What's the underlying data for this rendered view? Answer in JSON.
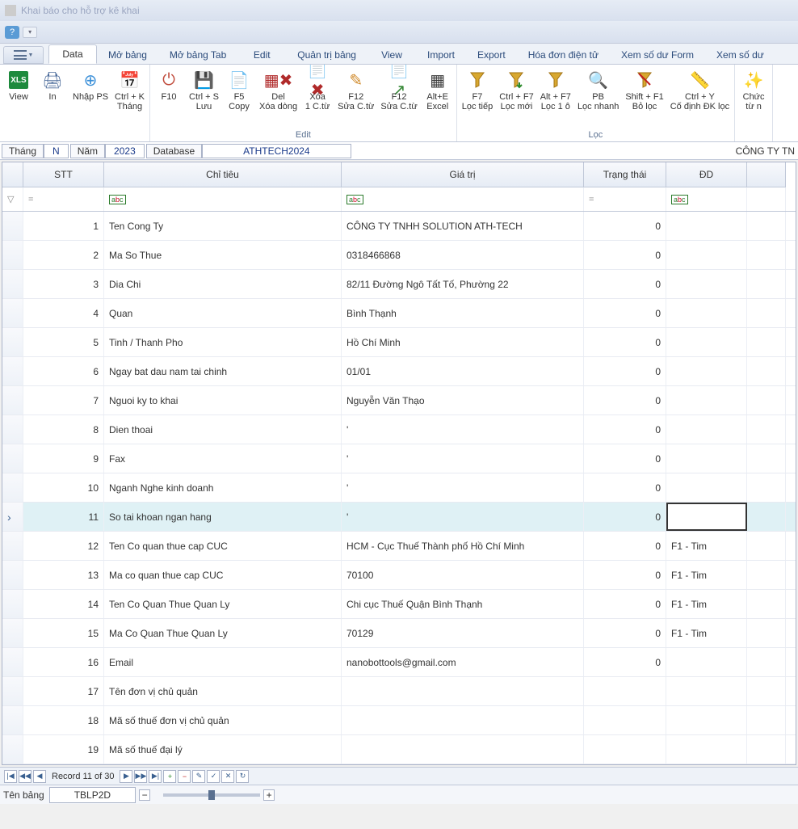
{
  "window": {
    "title": "Khai báo cho hỗ trợ kê khai"
  },
  "qat": {
    "help": "?"
  },
  "tabs": {
    "data": "Data",
    "moBang": "Mở bảng",
    "moBangTab": "Mở bảng Tab",
    "edit": "Edit",
    "quanTriBang": "Quản trị bảng",
    "view": "View",
    "import": "Import",
    "export": "Export",
    "hoaDon": "Hóa đơn điện tử",
    "xemSoDuForm": "Xem số dư Form",
    "xemSoDu": "Xem số dư"
  },
  "ribbon": {
    "view": "View",
    "in": "In",
    "nhapPs": "Nhập PS",
    "ctrlKThang": "Ctrl + K\nTháng",
    "f10": "F10",
    "ctrlSLuu": "Ctrl + S\nLưu",
    "f5Copy": "F5\nCopy",
    "delXoaDong": "Del\nXóa dòng",
    "xoa1Ctu": "Xóa\n1 C.từ",
    "f12SuaCtu": "F12\nSửa C.từ",
    "f12SuaCtu2": "F12\nSửa C.từ",
    "altEExcel": "Alt+E\nExcel",
    "f7LocTiep": "F7\nLọc tiếp",
    "ctrlF7LocMoi": "Ctrl + F7\nLọc mới",
    "altF7Loc1o": "Alt + F7\nLọc 1 ô",
    "pbLocNhanh": "PB\nLọc nhanh",
    "shiftF1BoLoc": "Shift + F1\nBỏ lọc",
    "ctrlYCoDinh": "Ctrl + Y\nCố định ĐK lọc",
    "chuc": "Chức\ntừ n",
    "groupEdit": "Edit",
    "groupLoc": "Lọc"
  },
  "info": {
    "thangLbl": "Tháng",
    "thangVal": "N",
    "namLbl": "Năm",
    "namVal": "2023",
    "dbLbl": "Database",
    "dbVal": "ATHTECH2024",
    "company": "CÔNG TY TN"
  },
  "grid": {
    "headers": {
      "stt": "STT",
      "chiTieu": "Chỉ tiêu",
      "giaTri": "Giá trị",
      "trangThai": "Trạng thái",
      "dd": "ĐD"
    },
    "filterEq": "=",
    "filterAbc": "abc",
    "rows": [
      {
        "stt": "1",
        "chiTieu": "Ten Cong Ty",
        "giaTri": "CÔNG TY TNHH SOLUTION ATH-TECH",
        "trang": "0",
        "dd": ""
      },
      {
        "stt": "2",
        "chiTieu": "Ma So Thue",
        "giaTri": "0318466868",
        "trang": "0",
        "dd": ""
      },
      {
        "stt": "3",
        "chiTieu": "Dia Chi",
        "giaTri": "82/11 Đường Ngô Tất Tố, Phường 22",
        "trang": "0",
        "dd": ""
      },
      {
        "stt": "4",
        "chiTieu": "Quan",
        "giaTri": "Bình Thạnh",
        "trang": "0",
        "dd": ""
      },
      {
        "stt": "5",
        "chiTieu": "Tinh / Thanh Pho",
        "giaTri": "Hồ Chí Minh",
        "trang": "0",
        "dd": ""
      },
      {
        "stt": "6",
        "chiTieu": "Ngay bat dau nam tai chinh",
        "giaTri": "01/01",
        "trang": "0",
        "dd": ""
      },
      {
        "stt": "7",
        "chiTieu": "Nguoi ky to khai",
        "giaTri": "Nguyễn Văn Thạo",
        "trang": "0",
        "dd": ""
      },
      {
        "stt": "8",
        "chiTieu": "Dien thoai",
        "giaTri": "'",
        "trang": "0",
        "dd": ""
      },
      {
        "stt": "9",
        "chiTieu": "Fax",
        "giaTri": "'",
        "trang": "0",
        "dd": ""
      },
      {
        "stt": "10",
        "chiTieu": "Nganh Nghe kinh doanh",
        "giaTri": "'",
        "trang": "0",
        "dd": ""
      },
      {
        "stt": "11",
        "chiTieu": "So tai khoan ngan hang",
        "giaTri": "'",
        "trang": "0",
        "dd": "",
        "selected": true
      },
      {
        "stt": "12",
        "chiTieu": "Ten Co quan thue cap CUC",
        "giaTri": "HCM - Cục Thuế Thành phố Hồ Chí Minh",
        "trang": "0",
        "dd": "F1 - Tim"
      },
      {
        "stt": "13",
        "chiTieu": "Ma co quan thue cap CUC",
        "giaTri": "70100",
        "trang": "0",
        "dd": "F1 - Tim"
      },
      {
        "stt": "14",
        "chiTieu": "Ten Co Quan Thue Quan Ly",
        "giaTri": "Chi cục Thuế Quận Bình Thạnh",
        "trang": "0",
        "dd": "F1 - Tim"
      },
      {
        "stt": "15",
        "chiTieu": "Ma Co Quan Thue Quan Ly",
        "giaTri": "70129",
        "trang": "0",
        "dd": "F1 - Tim"
      },
      {
        "stt": "16",
        "chiTieu": "Email",
        "giaTri": "nanobottools@gmail.com",
        "trang": "0",
        "dd": ""
      },
      {
        "stt": "17",
        "chiTieu": "Tên đơn vị chủ quản",
        "giaTri": "",
        "trang": "",
        "dd": ""
      },
      {
        "stt": "18",
        "chiTieu": "Mã số thuế đơn vị chủ quản",
        "giaTri": "",
        "trang": "",
        "dd": ""
      },
      {
        "stt": "19",
        "chiTieu": "Mã số thuế đại lý",
        "giaTri": "",
        "trang": "",
        "dd": ""
      }
    ]
  },
  "nav": {
    "record": "Record 11 of 30"
  },
  "footer": {
    "tenBangLbl": "Tên bảng",
    "tenBangVal": "TBLP2D"
  }
}
